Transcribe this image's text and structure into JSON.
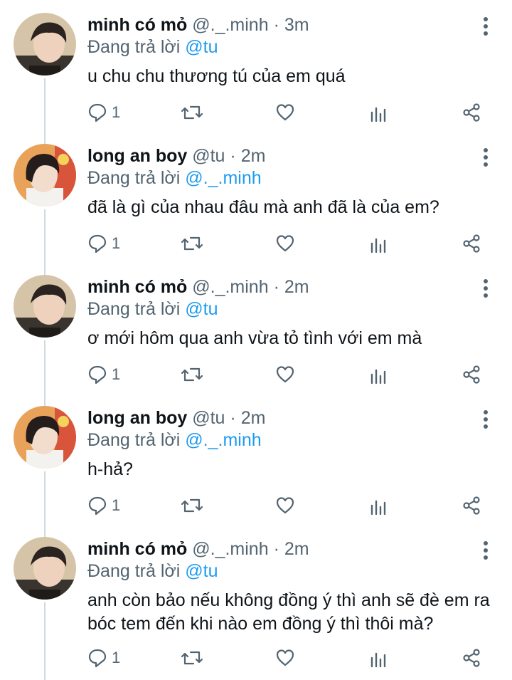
{
  "thread": {
    "tweets": [
      {
        "author": "minh",
        "display_name": "minh có mỏ",
        "handle": "@._.minh",
        "separator": "·",
        "time": "3m",
        "reply_prefix": "Đang trả lời",
        "reply_to": "@tu",
        "text": "u chu chu thương tú của em quá",
        "reply_count": "1"
      },
      {
        "author": "long",
        "display_name": "long an boy",
        "handle": "@tu",
        "separator": "·",
        "time": "2m",
        "reply_prefix": "Đang trả lời",
        "reply_to": "@._.minh",
        "text": "đã là gì của nhau đâu mà anh đã là của em?",
        "reply_count": "1"
      },
      {
        "author": "minh",
        "display_name": "minh có mỏ",
        "handle": "@._.minh",
        "separator": "·",
        "time": "2m",
        "reply_prefix": "Đang trả lời",
        "reply_to": "@tu",
        "text": "ơ mới hôm qua anh vừa tỏ tình với em mà",
        "reply_count": "1"
      },
      {
        "author": "long",
        "display_name": "long an boy",
        "handle": "@tu",
        "separator": "·",
        "time": "2m",
        "reply_prefix": "Đang trả lời",
        "reply_to": "@._.minh",
        "text": "h-hả?",
        "reply_count": "1"
      },
      {
        "author": "minh",
        "display_name": "minh có mỏ",
        "handle": "@._.minh",
        "separator": "·",
        "time": "2m",
        "reply_prefix": "Đang trả lời",
        "reply_to": "@tu",
        "text": "anh còn bảo nếu không đồng ý thì anh sẽ đè em ra bóc tem đến khi nào em đồng ý thì thôi mà?",
        "reply_count": "1"
      }
    ]
  },
  "icons": {
    "reply": "reply-icon",
    "retweet": "retweet-icon",
    "like": "heart-icon",
    "analytics": "analytics-icon",
    "share": "share-icon",
    "more": "more-vertical-icon"
  },
  "colors": {
    "text": "#0f1419",
    "secondary": "#536471",
    "mention": "#1d9bf0",
    "thread_line": "#cfd9de"
  }
}
